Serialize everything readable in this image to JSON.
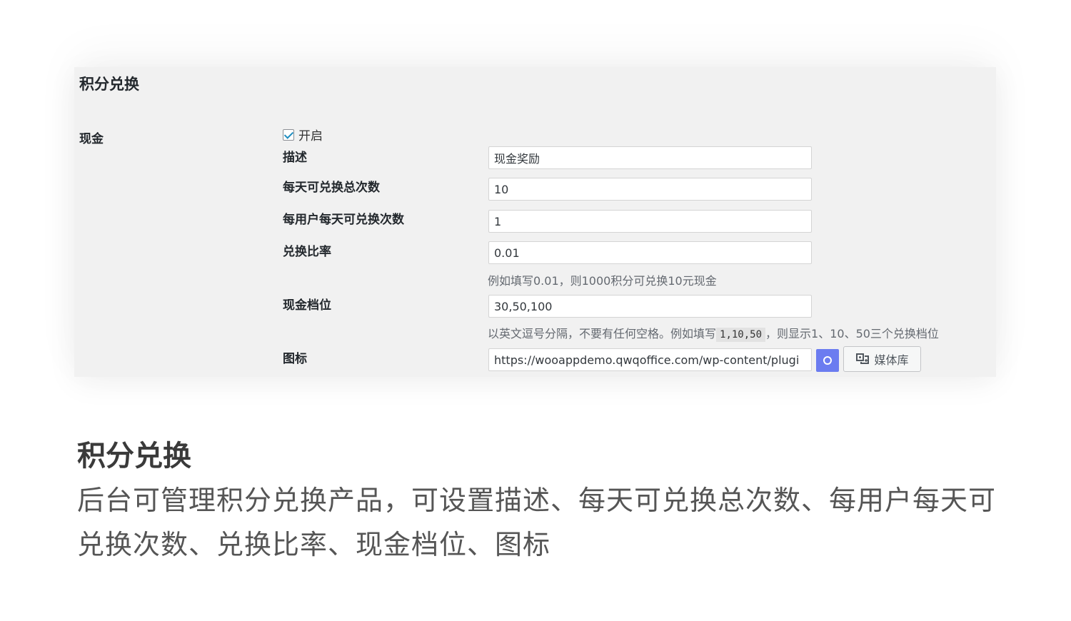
{
  "panel": {
    "title": "积分兑换",
    "section_label": "现金",
    "enable_label": "开启",
    "enabled": true,
    "fields": {
      "description": {
        "label": "描述",
        "value": "现金奖励"
      },
      "daily_total": {
        "label": "每天可兑换总次数",
        "value": "10"
      },
      "per_user_daily": {
        "label": "每用户每天可兑换次数",
        "value": "1"
      },
      "ratio": {
        "label": "兑换比率",
        "value": "0.01",
        "hint": "例如填写0.01，则1000积分可兑换10元现金"
      },
      "tiers": {
        "label": "现金档位",
        "value": "30,50,100",
        "hint_prefix": "以英文逗号分隔，不要有任何空格。例如填写",
        "hint_code": "1,10,50",
        "hint_suffix": "，则显示1、10、50三个兑换档位"
      },
      "icon": {
        "label": "图标",
        "value": "https://wooappdemo.qwqoffice.com/wp-content/plugi",
        "media_button_label": "媒体库"
      }
    }
  },
  "caption": {
    "title": "积分兑换",
    "description": "后台可管理积分兑换产品，可设置描述、每天可兑换总次数、每用户每天可兑换次数、兑换比率、现金档位、图标"
  },
  "icons": {
    "checkbox": "checkmark-icon",
    "preview": "preview-dot-icon",
    "media": "media-library-icon"
  },
  "colors": {
    "panel_bg": "#f1f1f1",
    "preview_button": "#6b7cf0",
    "check": "#1e8cbe"
  }
}
